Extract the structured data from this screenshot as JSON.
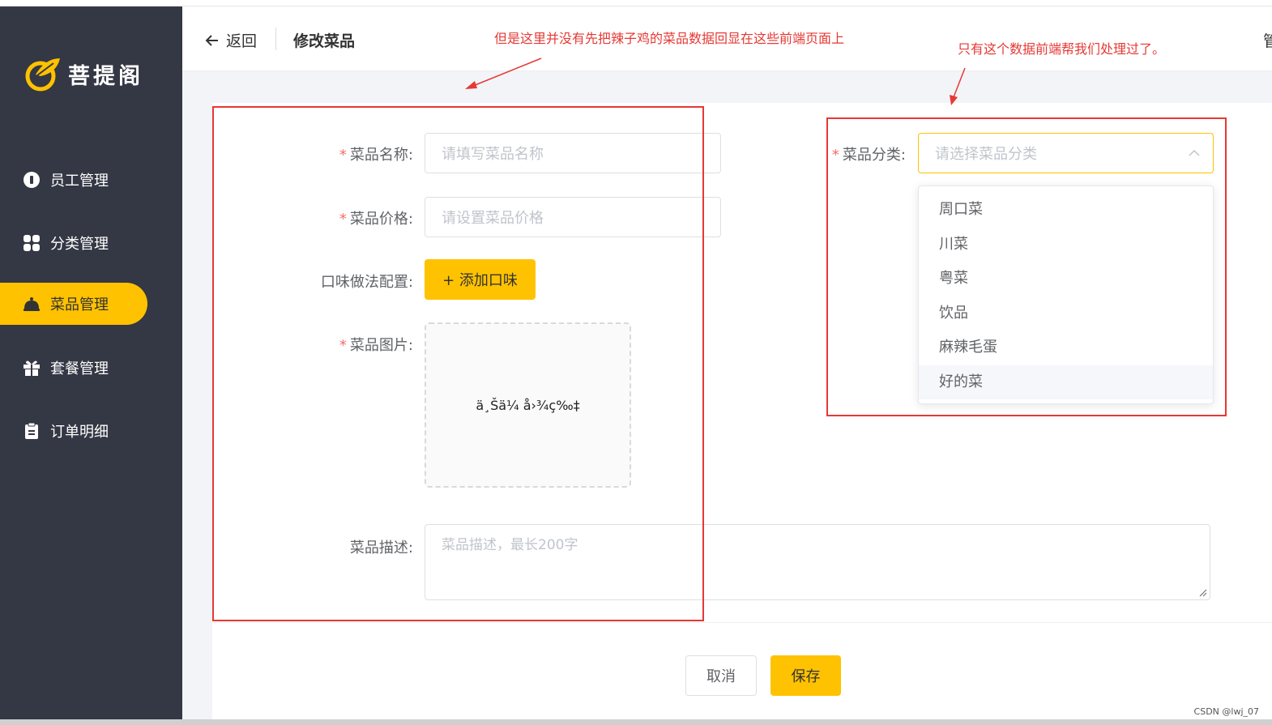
{
  "app": {
    "logo_text": "菩提阁"
  },
  "sidebar": {
    "items": [
      {
        "label": "员工管理",
        "icon": "employee-icon"
      },
      {
        "label": "分类管理",
        "icon": "category-icon"
      },
      {
        "label": "菜品管理",
        "icon": "dish-icon",
        "active": true
      },
      {
        "label": "套餐管理",
        "icon": "gift-icon"
      },
      {
        "label": "订单明细",
        "icon": "clipboard-icon"
      }
    ]
  },
  "header": {
    "back_label": "返回",
    "title": "修改菜品",
    "right_text": "管"
  },
  "form": {
    "name": {
      "label": "菜品名称:",
      "placeholder": "请填写菜品名称"
    },
    "price": {
      "label": "菜品价格:",
      "placeholder": "请设置菜品价格"
    },
    "flavor": {
      "label": "口味做法配置:",
      "button": "+ 添加口味"
    },
    "image": {
      "label": "菜品图片:",
      "upload_text": "ä¸Šä¼ å›¾ç‰‡"
    },
    "description": {
      "label": "菜品描述:",
      "placeholder": "菜品描述，最长200字"
    },
    "category": {
      "label": "菜品分类:",
      "placeholder": "请选择菜品分类",
      "options": [
        "周口菜",
        "川菜",
        "粤菜",
        "饮品",
        "麻辣毛蛋",
        "好的菜"
      ]
    }
  },
  "footer": {
    "cancel": "取消",
    "save": "保存"
  },
  "annotations": {
    "left": "但是这里并没有先把辣子鸡的菜品数据回显在这些前端页面上",
    "right": "只有这个数据前端帮我们处理过了。"
  },
  "watermark": "CSDN @lwj_07",
  "colors": {
    "accent": "#ffc200",
    "sidebar": "#343744",
    "annotation": "#e53935"
  }
}
